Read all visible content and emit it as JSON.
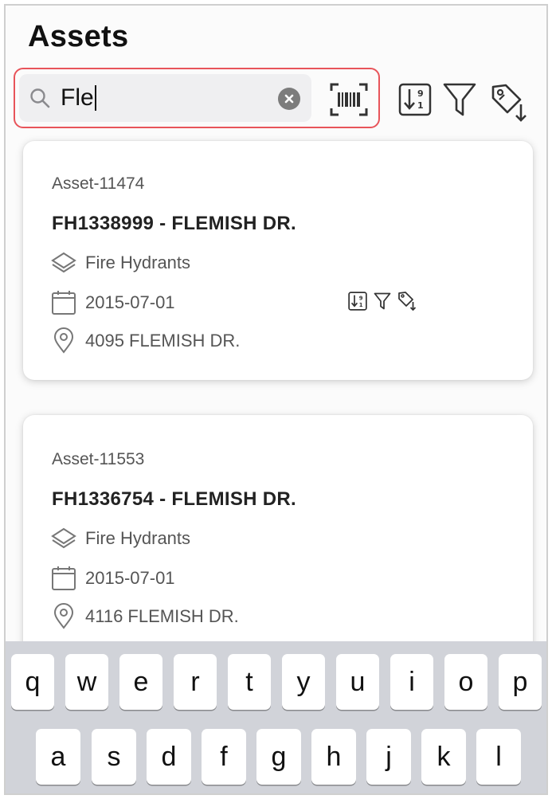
{
  "header": {
    "title": "Assets"
  },
  "search": {
    "value": "Fle",
    "placeholder": ""
  },
  "toolbar": {
    "icons": [
      "search-icon",
      "clear-icon",
      "barcode-scan-icon",
      "sort-icon",
      "filter-icon",
      "tag-download-icon"
    ]
  },
  "assets": [
    {
      "id": "Asset-11474",
      "name": "FH1338999 - FLEMISH DR.",
      "category": "Fire Hydrants",
      "date": "2015-07-01",
      "address": "4095 FLEMISH DR."
    },
    {
      "id": "Asset-11553",
      "name": "FH1336754 - FLEMISH DR.",
      "category": "Fire Hydrants",
      "date": "2015-07-01",
      "address": "4116 FLEMISH DR."
    }
  ],
  "keyboard": {
    "row1": [
      "q",
      "w",
      "e",
      "r",
      "t",
      "y",
      "u",
      "i",
      "o",
      "p"
    ],
    "row2": [
      "a",
      "s",
      "d",
      "f",
      "g",
      "h",
      "j",
      "k",
      "l"
    ]
  },
  "colors": {
    "highlight": "#e8545a",
    "search_bg": "#efeff1",
    "keyboard_bg": "#d1d3d9"
  }
}
